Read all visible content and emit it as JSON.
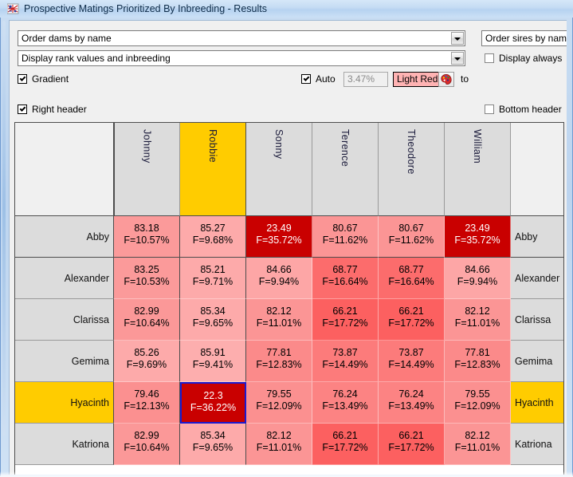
{
  "window": {
    "title": "Prospective Matings Prioritized By Inbreeding - Results",
    "icon": "app-icon"
  },
  "toolbar": {
    "dam_order_combo": {
      "value": "Order dams by name",
      "icon": "chevron-down-icon"
    },
    "display_mode_combo": {
      "value": "Display rank values and inbreeding",
      "icon": "chevron-down-icon"
    },
    "sire_order_combo": {
      "value": "Order sires by name"
    },
    "display_always_checkbox": {
      "label": "Display always",
      "checked": false
    },
    "gradient_checkbox": {
      "label": "Gradient",
      "checked": true
    },
    "auto_checkbox": {
      "label": "Auto",
      "checked": true
    },
    "threshold_value": "3.47%",
    "color_name": "Light Red",
    "color_swatch_hex": "#ffb3b3",
    "palette_button_icon": "color-palette-icon",
    "to_label": "to",
    "right_header_checkbox": {
      "label": "Right header",
      "checked": true
    },
    "bottom_header_checkbox": {
      "label": "Bottom header",
      "checked": false
    }
  },
  "grid": {
    "selected_column": "Robbie",
    "selected_row": "Hyacinth",
    "selection_border_hex": "#1a1ad0",
    "header_highlight_hex": "#ffcc00",
    "columns": [
      "Johnny",
      "Robbie",
      "Sonny",
      "Terence",
      "Theodore",
      "William"
    ],
    "rows": [
      "Abby",
      "Alexander",
      "Clarissa",
      "Gemima",
      "Hyacinth",
      "Katriona"
    ],
    "cells": [
      [
        {
          "rank": "83.18",
          "f": "F=10.57%",
          "bg": "#fb9a9a",
          "fg": "#000000"
        },
        {
          "rank": "85.27",
          "f": "F=9.68%",
          "bg": "#fdaaaa",
          "fg": "#000000"
        },
        {
          "rank": "23.49",
          "f": "F=35.72%",
          "bg": "#c90000",
          "fg": "#ffffff"
        },
        {
          "rank": "80.67",
          "f": "F=11.62%",
          "bg": "#fb9595",
          "fg": "#000000"
        },
        {
          "rank": "80.67",
          "f": "F=11.62%",
          "bg": "#fb9595",
          "fg": "#000000"
        },
        {
          "rank": "23.49",
          "f": "F=35.72%",
          "bg": "#c90000",
          "fg": "#ffffff"
        }
      ],
      [
        {
          "rank": "83.25",
          "f": "F=10.53%",
          "bg": "#fb9a9a",
          "fg": "#000000"
        },
        {
          "rank": "85.21",
          "f": "F=9.71%",
          "bg": "#fdaaaa",
          "fg": "#000000"
        },
        {
          "rank": "84.66",
          "f": "F=9.94%",
          "bg": "#fda6a6",
          "fg": "#000000"
        },
        {
          "rank": "68.77",
          "f": "F=16.64%",
          "bg": "#fc6c6c",
          "fg": "#000000"
        },
        {
          "rank": "68.77",
          "f": "F=16.64%",
          "bg": "#fc6c6c",
          "fg": "#000000"
        },
        {
          "rank": "84.66",
          "f": "F=9.94%",
          "bg": "#fda6a6",
          "fg": "#000000"
        }
      ],
      [
        {
          "rank": "82.99",
          "f": "F=10.64%",
          "bg": "#fb9898",
          "fg": "#000000"
        },
        {
          "rank": "85.34",
          "f": "F=9.65%",
          "bg": "#fdaaaa",
          "fg": "#000000"
        },
        {
          "rank": "82.12",
          "f": "F=11.01%",
          "bg": "#fb9595",
          "fg": "#000000"
        },
        {
          "rank": "66.21",
          "f": "F=17.72%",
          "bg": "#fc6060",
          "fg": "#000000"
        },
        {
          "rank": "66.21",
          "f": "F=17.72%",
          "bg": "#fc6060",
          "fg": "#000000"
        },
        {
          "rank": "82.12",
          "f": "F=11.01%",
          "bg": "#fb9595",
          "fg": "#000000"
        }
      ],
      [
        {
          "rank": "85.26",
          "f": "F=9.69%",
          "bg": "#fdaaaa",
          "fg": "#000000"
        },
        {
          "rank": "85.91",
          "f": "F=9.41%",
          "bg": "#fdaeae",
          "fg": "#000000"
        },
        {
          "rank": "77.81",
          "f": "F=12.83%",
          "bg": "#fb8a8a",
          "fg": "#000000"
        },
        {
          "rank": "73.87",
          "f": "F=14.49%",
          "bg": "#fc7b7b",
          "fg": "#000000"
        },
        {
          "rank": "73.87",
          "f": "F=14.49%",
          "bg": "#fc7b7b",
          "fg": "#000000"
        },
        {
          "rank": "77.81",
          "f": "F=12.83%",
          "bg": "#fb8a8a",
          "fg": "#000000"
        }
      ],
      [
        {
          "rank": "79.46",
          "f": "F=12.13%",
          "bg": "#fb9090",
          "fg": "#000000"
        },
        {
          "rank": "22.3",
          "f": "F=36.22%",
          "bg": "#c90000",
          "fg": "#ffffff",
          "selected": true
        },
        {
          "rank": "79.55",
          "f": "F=12.09%",
          "bg": "#fb9090",
          "fg": "#000000"
        },
        {
          "rank": "76.24",
          "f": "F=13.49%",
          "bg": "#fc8383",
          "fg": "#000000"
        },
        {
          "rank": "76.24",
          "f": "F=13.49%",
          "bg": "#fc8383",
          "fg": "#000000"
        },
        {
          "rank": "79.55",
          "f": "F=12.09%",
          "bg": "#fb9090",
          "fg": "#000000"
        }
      ],
      [
        {
          "rank": "82.99",
          "f": "F=10.64%",
          "bg": "#fb9898",
          "fg": "#000000"
        },
        {
          "rank": "85.34",
          "f": "F=9.65%",
          "bg": "#fdaaaa",
          "fg": "#000000"
        },
        {
          "rank": "82.12",
          "f": "F=11.01%",
          "bg": "#fb9595",
          "fg": "#000000"
        },
        {
          "rank": "66.21",
          "f": "F=17.72%",
          "bg": "#fc6060",
          "fg": "#000000"
        },
        {
          "rank": "66.21",
          "f": "F=17.72%",
          "bg": "#fc6060",
          "fg": "#000000"
        },
        {
          "rank": "82.12",
          "f": "F=11.01%",
          "bg": "#fb9595",
          "fg": "#000000"
        }
      ]
    ]
  }
}
